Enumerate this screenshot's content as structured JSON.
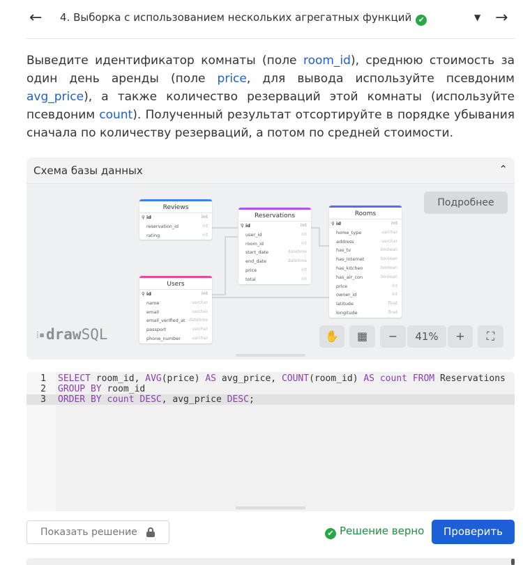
{
  "header": {
    "title": "4. Выборка с использованием нескольких агрегатных функций",
    "check_glyph": "✔",
    "back_glyph": "←",
    "forward_glyph": "→",
    "dropdown_glyph": "▼"
  },
  "task": {
    "t1": "Выведите идентификатор комнаты (поле ",
    "k1": "room_id",
    "t2": "), среднюю стоимость за один день аренды (поле ",
    "k2": "price",
    "t3": ", для вывода используйте псевдоним ",
    "k3": "avg_price",
    "t4": "), а также количество резерваций этой комнаты (используйте псевдоним ",
    "k4": "count",
    "t5": "). Полученный результат отсортируйте в порядке убывания сначала по количеству резерваций, а потом по средней стоимости."
  },
  "schema": {
    "title": "Схема базы данных",
    "toggle_glyph": "⌃",
    "more_label": "Подробнее",
    "brand": {
      "part1": "draw",
      "part2": "SQL"
    },
    "zoom": {
      "hand": "✋",
      "grid": "▦",
      "minus": "−",
      "level": "41%",
      "plus": "+",
      "fit": "⛶"
    },
    "tables": {
      "reviews": {
        "name": "Reviews",
        "color": "#3b82f6",
        "columns": [
          {
            "name": "id",
            "type": "int",
            "pk": true
          },
          {
            "name": "reservation_id",
            "type": "int"
          },
          {
            "name": "rating",
            "type": "int"
          }
        ]
      },
      "reservations": {
        "name": "Reservations",
        "color": "#a855f7",
        "columns": [
          {
            "name": "id",
            "type": "int",
            "pk": true
          },
          {
            "name": "user_id",
            "type": "int"
          },
          {
            "name": "room_id",
            "type": "int"
          },
          {
            "name": "start_date",
            "type": "datetime"
          },
          {
            "name": "end_date",
            "type": "datetime"
          },
          {
            "name": "price",
            "type": "int"
          },
          {
            "name": "total",
            "type": "int"
          }
        ]
      },
      "rooms": {
        "name": "Rooms",
        "color": "#6366f1",
        "columns": [
          {
            "name": "id",
            "type": "int",
            "pk": true
          },
          {
            "name": "home_type",
            "type": "varchar"
          },
          {
            "name": "address",
            "type": "varchar"
          },
          {
            "name": "has_tv",
            "type": "boolean"
          },
          {
            "name": "has_internet",
            "type": "boolean"
          },
          {
            "name": "has_kitchen",
            "type": "boolean"
          },
          {
            "name": "has_air_con",
            "type": "boolean"
          },
          {
            "name": "price",
            "type": "int"
          },
          {
            "name": "owner_id",
            "type": "int"
          },
          {
            "name": "latitude",
            "type": "float"
          },
          {
            "name": "longitude",
            "type": "float"
          }
        ]
      },
      "users": {
        "name": "Users",
        "color": "#ec4899",
        "columns": [
          {
            "name": "id",
            "type": "int",
            "pk": true
          },
          {
            "name": "name",
            "type": "varchar"
          },
          {
            "name": "email",
            "type": "varchar"
          },
          {
            "name": "email_verified_at",
            "type": "datetime"
          },
          {
            "name": "passport",
            "type": "varchar"
          },
          {
            "name": "phone_number",
            "type": "varchar"
          }
        ]
      }
    }
  },
  "editor": {
    "lines": [
      {
        "num": "1",
        "tokens": [
          {
            "t": "SELECT",
            "k": true
          },
          {
            "t": " room_id, "
          },
          {
            "t": "AVG",
            "k": true
          },
          {
            "t": "(price) "
          },
          {
            "t": "AS",
            "k": true
          },
          {
            "t": " avg_price, "
          },
          {
            "t": "COUNT",
            "k": true
          },
          {
            "t": "(room_id) "
          },
          {
            "t": "AS",
            "k": true
          },
          {
            "t": " "
          },
          {
            "t": "count",
            "k": true
          },
          {
            "t": " "
          },
          {
            "t": "FROM",
            "k": true
          },
          {
            "t": " Reservations"
          }
        ]
      },
      {
        "num": "2",
        "tokens": [
          {
            "t": "GROUP BY",
            "k": true
          },
          {
            "t": " room_id"
          }
        ]
      },
      {
        "num": "3",
        "active": true,
        "tokens": [
          {
            "t": "ORDER BY",
            "k": true
          },
          {
            "t": " "
          },
          {
            "t": "count",
            "k": true
          },
          {
            "t": " "
          },
          {
            "t": "DESC",
            "k": true
          },
          {
            "t": ", avg_price "
          },
          {
            "t": "DESC",
            "k": true
          },
          {
            "t": ";"
          }
        ]
      }
    ]
  },
  "footer": {
    "show_solution_label": "Показать решение",
    "status_text": "Решение верно",
    "check_label": "Проверить"
  },
  "colors": {
    "accent": "#1d5fd6",
    "success": "#29a745",
    "keyword": "#8a3fb0"
  }
}
